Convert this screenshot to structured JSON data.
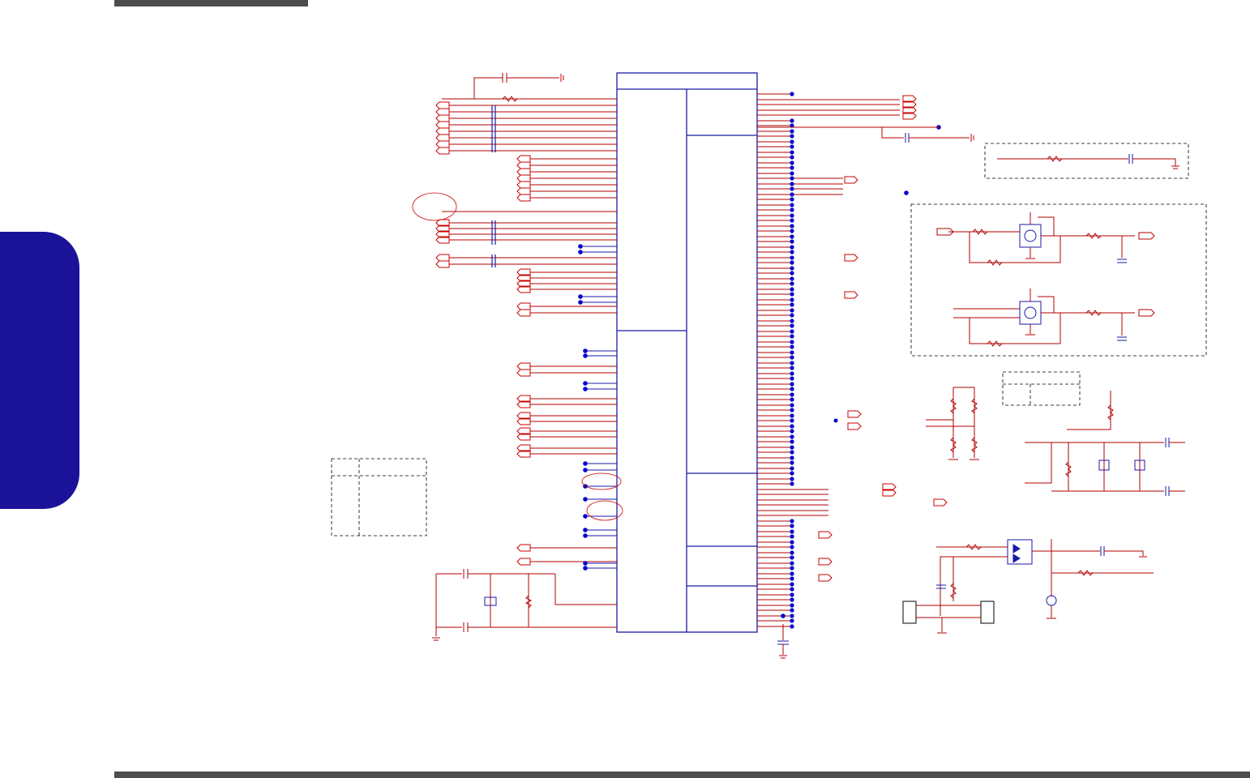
{
  "page": {
    "header_bar_color": "#4d4d4d",
    "footer_bar_color": "#4d4d4d",
    "side_tab_color": "#1a1399"
  },
  "schematic": {
    "wire_color": "#b30000",
    "chip_color": "#1a1aa8",
    "junction_color": "#cc00cc",
    "node_color": "#0000cc",
    "text_labels": []
  }
}
